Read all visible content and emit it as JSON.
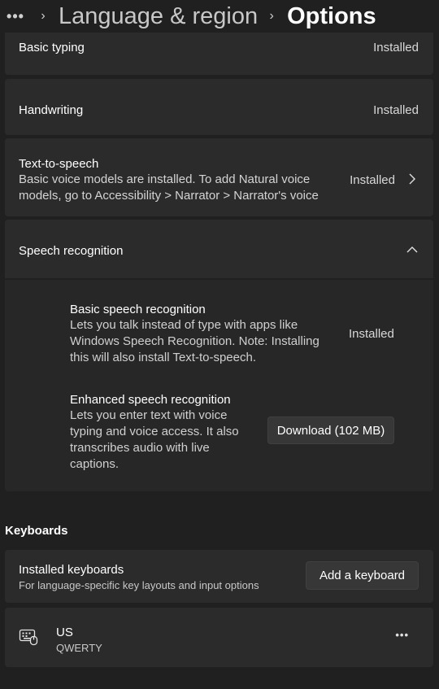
{
  "header": {
    "more_label": "•••",
    "chevron": "›",
    "crumb_parent": "Language & region",
    "crumb_current": "Options"
  },
  "features": {
    "basic_typing": {
      "title": "Basic typing",
      "status": "Installed"
    },
    "handwriting": {
      "title": "Handwriting",
      "status": "Installed"
    },
    "text_to_speech": {
      "title": "Text-to-speech",
      "description_line1": "Basic voice models are installed. To add Natural voice",
      "description_line2": "models, go to Accessibility > Narrator > Narrator's voice",
      "status": "Installed",
      "icon": "chevron-right-icon"
    },
    "speech_recognition": {
      "title": "Speech recognition",
      "icon": "chevron-up-icon",
      "basic": {
        "title": "Basic speech recognition",
        "desc_line1": "Lets you talk instead of type with apps like",
        "desc_line2": "Windows Speech Recognition. Note: Installing",
        "desc_line3": "this will also install Text-to-speech.",
        "status": "Installed"
      },
      "enhanced": {
        "title": "Enhanced speech recognition",
        "desc_line1": "Lets you enter text with voice",
        "desc_line2": "typing and voice access. It also",
        "desc_line3": "transcribes audio with live",
        "desc_line4": "captions.",
        "button_label": "Download (102 MB)"
      }
    }
  },
  "keyboards": {
    "section_title": "Keyboards",
    "installed": {
      "title": "Installed keyboards",
      "description": "For language-specific key layouts and input options",
      "button_label": "Add a keyboard"
    },
    "items": [
      {
        "name": "US",
        "layout": "QWERTY",
        "icon": "keyboard-icon",
        "more": "•••"
      }
    ]
  },
  "colors": {
    "background": "#202020",
    "card": "#2b2b2b",
    "button": "#373737"
  }
}
